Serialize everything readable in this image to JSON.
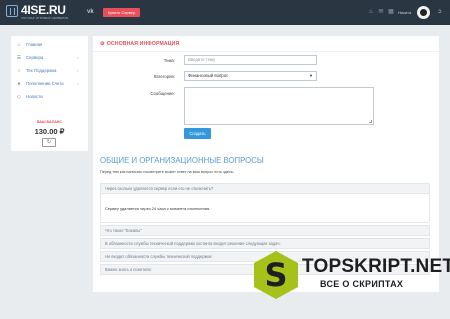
{
  "header": {
    "logo_brand": "4ISE.RU",
    "logo_tagline": "ХОСТИНГ ИГРОВЫХ СЕРВЕРОВ",
    "vk_label": "vk",
    "button_label": "Купить Сервер",
    "icons": [
      "bell-icon",
      "mail-icon",
      "calendar-icon",
      "exit-icon"
    ],
    "user_name": "Никита"
  },
  "sidebar": {
    "items": [
      {
        "label": "Главная",
        "icon": "home-icon",
        "has_submenu": false
      },
      {
        "label": "Сервера",
        "icon": "server-icon",
        "has_submenu": true
      },
      {
        "label": "Тех.Поддержка",
        "icon": "support-icon",
        "has_submenu": true
      },
      {
        "label": "Пополнение Счета",
        "icon": "wallet-icon",
        "has_submenu": true
      },
      {
        "label": "Новости",
        "icon": "news-icon",
        "has_submenu": false
      }
    ],
    "balance_label": "ВАШ БАЛАНС",
    "balance_value": "130.00 ₽",
    "balance_button_icon": "refresh-icon"
  },
  "form": {
    "section_title": "ОСНОВНАЯ ИНФОРМАЦИЯ",
    "subject_label": "Тема:",
    "subject_placeholder": "Введите тему",
    "category_label": "Категория:",
    "category_value": "Финансовый вопрос",
    "message_label": "Сообщение:",
    "submit_label": "Создать"
  },
  "faq": {
    "title": "ОБЩИЕ И ОРГАНИЗАЦИОННЫЕ ВОПРОСЫ",
    "note": "Перед тем как написать посмотрите может ответ на ваш вопрос есть здесь:",
    "items": [
      {
        "question": "Через сколько удаляется сервер если его не отключить?",
        "answer": "Сервер удаляется через 24 часа с момента отключения."
      },
      {
        "question": "Что такое \"Бэкапы\"",
        "answer": ""
      },
      {
        "question": "В обязанности службы технической поддержки хостинга входит решение следующих задач:",
        "answer": ""
      },
      {
        "question": "Не входит обязанности службы технической поддержки:",
        "answer": ""
      },
      {
        "question": "Важно знать о понятиях:",
        "answer": ""
      }
    ]
  },
  "watermark": {
    "letter": "S",
    "name": "TOPSKRIPT.NET",
    "subtitle": "ВСЕ О СКРИПТАХ",
    "accent_color": "#a5c11a"
  }
}
